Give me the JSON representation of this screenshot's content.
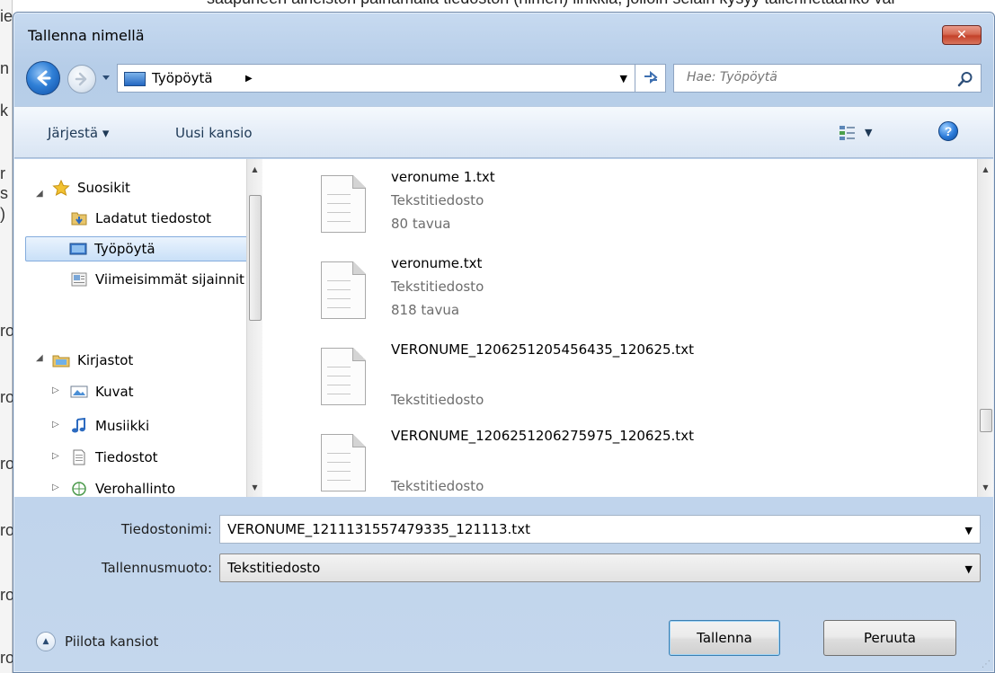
{
  "background": {
    "top_text": "saapuneen aineiston painamalla tiedoston (nimen) linkkiä, jolloin selain kysyy tallennetaanko vai",
    "left_chars": [
      "ie",
      "n",
      "k",
      "r",
      "s",
      ")",
      "ro",
      "ro",
      "ro",
      "ro",
      "ro",
      "ro"
    ]
  },
  "dialog": {
    "title": "Tallenna nimellä",
    "close_label": "✕"
  },
  "address": {
    "location": "Työpöytä",
    "search_placeholder": "Hae: Työpöytä"
  },
  "toolbar": {
    "organize_label": "Järjestä ▾",
    "new_folder_label": "Uusi kansio",
    "help_label": "?"
  },
  "nav": {
    "favorites_label": "Suosikit",
    "favorites": [
      "Ladatut tiedostot",
      "Työpöytä",
      "Viimeisimmät sijainnit"
    ],
    "libraries_label": "Kirjastot",
    "libraries": [
      "Kuvat",
      "Musiikki",
      "Tiedostot",
      "Verohallinto"
    ]
  },
  "files": [
    {
      "name": "veronume 1.txt",
      "type": "Tekstitiedosto",
      "size": "80 tavua"
    },
    {
      "name": "veronume.txt",
      "type": "Tekstitiedosto",
      "size": "818 tavua"
    },
    {
      "name": "VERONUME_1206251205456435_120625.txt",
      "type": "Tekstitiedosto",
      "size": ""
    },
    {
      "name": "VERONUME_1206251206275975_120625.txt",
      "type": "Tekstitiedosto",
      "size": ""
    }
  ],
  "form": {
    "filename_label": "Tiedostonimi:",
    "filename_value": "VERONUME_1211131557479335_121113.txt",
    "filetype_label": "Tallennusmuoto:",
    "filetype_value": "Tekstitiedosto",
    "hide_folders_label": "Piilota kansiot",
    "save_label": "Tallenna",
    "cancel_label": "Peruuta"
  },
  "colors": {
    "frame": "#b6cde8",
    "selection": "#c9e0f8",
    "close_red": "#c4412a"
  }
}
